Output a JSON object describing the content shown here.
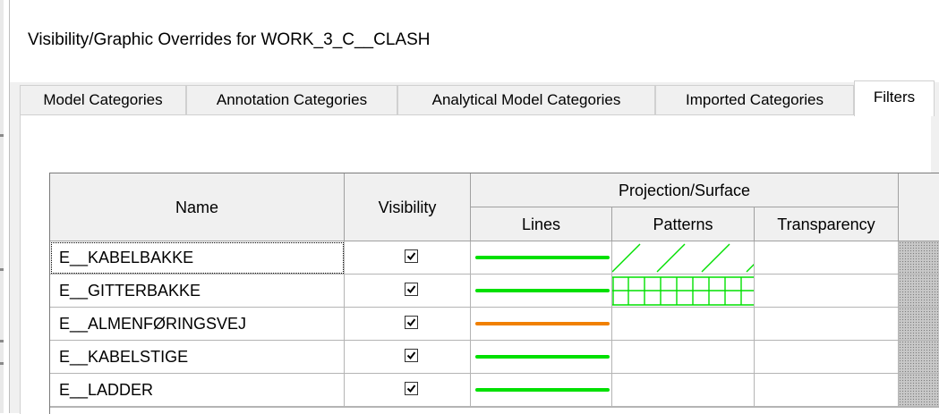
{
  "window": {
    "title": "Visibility/Graphic Overrides for WORK_3_C__CLASH"
  },
  "tabs": [
    {
      "label": "Model Categories",
      "active": false
    },
    {
      "label": "Annotation Categories",
      "active": false
    },
    {
      "label": "Analytical Model Categories",
      "active": false
    },
    {
      "label": "Imported Categories",
      "active": false
    },
    {
      "label": "Filters",
      "active": true
    }
  ],
  "table": {
    "headers": {
      "name": "Name",
      "visibility": "Visibility",
      "projection_surface": "Projection/Surface",
      "lines": "Lines",
      "patterns": "Patterns",
      "transparency": "Transparency"
    },
    "rows": [
      {
        "name": "E__KABELBAKKE",
        "visible": true,
        "line_color": "#00e000",
        "pattern": "diagonal",
        "pattern_color": "#00e000"
      },
      {
        "name": "E__GITTERBAKKE",
        "visible": true,
        "line_color": "#00e000",
        "pattern": "grid",
        "pattern_color": "#00e000"
      },
      {
        "name": "E__ALMENFØRINGSVEJ",
        "visible": true,
        "line_color": "#f08000",
        "pattern": "none",
        "pattern_color": ""
      },
      {
        "name": "E__KABELSTIGE",
        "visible": true,
        "line_color": "#00e000",
        "pattern": "none",
        "pattern_color": ""
      },
      {
        "name": "E__LADDER",
        "visible": true,
        "line_color": "#00e000",
        "pattern": "none",
        "pattern_color": ""
      }
    ]
  }
}
